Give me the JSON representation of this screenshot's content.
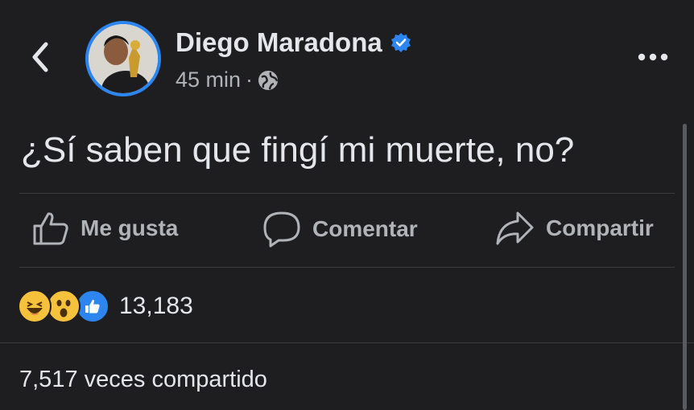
{
  "post": {
    "author": "Diego Maradona",
    "verified": true,
    "time": "45 min",
    "separator": "·",
    "audience_icon": "globe-icon",
    "text": "¿Sí saben que fingí mi muerte, no?"
  },
  "actions": {
    "like_label": "Me gusta",
    "comment_label": "Comentar",
    "share_label": "Compartir"
  },
  "reactions": {
    "icons": [
      "haha-icon",
      "wow-icon",
      "like-icon"
    ],
    "count": "13,183"
  },
  "shares_text": "7,517 veces compartido",
  "colors": {
    "background": "#1e1e20",
    "text_primary": "#e4e6eb",
    "text_secondary": "#b0b3b8",
    "verified_blue": "#2d86f0",
    "reaction_yellow": "#f7c23b",
    "divider": "#3a3b3d"
  }
}
